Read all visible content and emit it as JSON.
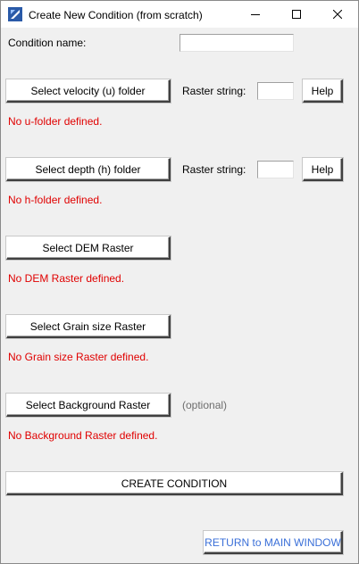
{
  "window": {
    "title": "Create New Condition (from scratch)",
    "controls": {
      "minimize": "minimize-icon",
      "maximize": "maximize-icon",
      "close": "close-icon"
    }
  },
  "form": {
    "condition_name_label": "Condition name:",
    "condition_name_value": ""
  },
  "velocity": {
    "button": "Select velocity (u) folder",
    "raster_label": "Raster string:",
    "raster_value": "",
    "help": "Help",
    "status": "No u-folder defined."
  },
  "depth": {
    "button": "Select depth (h) folder",
    "raster_label": "Raster string:",
    "raster_value": "",
    "help": "Help",
    "status": "No h-folder defined."
  },
  "dem": {
    "button": "Select DEM Raster",
    "status": "No DEM Raster defined."
  },
  "grain": {
    "button": "Select Grain size Raster",
    "status": "No Grain size Raster defined."
  },
  "background": {
    "button": "Select Background Raster",
    "optional": "(optional)",
    "status": "No Background Raster defined."
  },
  "actions": {
    "create": "CREATE CONDITION",
    "return": "RETURN to MAIN WINDOW"
  },
  "colors": {
    "status_text": "#e00000",
    "optional_text": "#6d6d6d",
    "return_text": "#3a6fd8",
    "background": "#f0f0f0"
  }
}
